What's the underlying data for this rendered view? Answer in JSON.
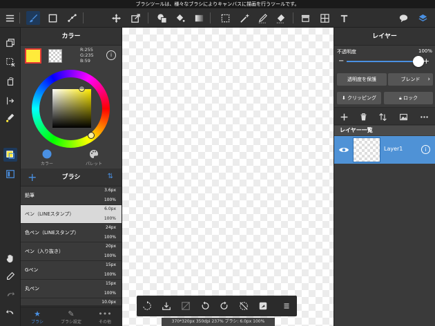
{
  "tooltip": "ブラシツールは、様々なブラシによりキャンバスに描画を行うツールです。",
  "colors": {
    "accent": "#4a90e2",
    "fg_color": "#ffeb3b",
    "selected_layer": "#4f92d6"
  },
  "toolbar": {
    "icons": [
      "menu-icon",
      "brush-icon",
      "shape-icon",
      "select-pen-icon",
      "move-icon",
      "transform-icon",
      "fill-shape-icon",
      "bucket-icon",
      "gradient-icon",
      "select-rect-icon",
      "magic-wand-icon",
      "select-pen-icon-2",
      "select-eraser-icon",
      "store-icon",
      "frame-icon",
      "text-icon",
      "speech-bubble-icon",
      "layers-icon"
    ]
  },
  "color_panel": {
    "title": "カラー",
    "rgb": {
      "r": "R:255",
      "g": "G:235",
      "b": "B:59"
    },
    "info": "i",
    "tabs": [
      "カラー",
      "パレット"
    ]
  },
  "brush_panel": {
    "title": "ブラシ",
    "add": "+",
    "sort": "⇅",
    "items": [
      {
        "name": "鉛筆",
        "size": "3.6px",
        "opacity": "100%"
      },
      {
        "name": "ペン（LINEスタンプ）",
        "size": "6.0px",
        "opacity": "100%",
        "selected": true
      },
      {
        "name": "色ペン（LINEスタンプ）",
        "size": "24px",
        "opacity": "100%"
      },
      {
        "name": "ペン（入り抜き）",
        "size": "20px",
        "opacity": "100%"
      },
      {
        "name": "Gペン",
        "size": "15px",
        "opacity": "100%"
      },
      {
        "name": "丸ペン",
        "size": "15px",
        "opacity": "100%"
      },
      {
        "name": "",
        "size": "10.0px",
        "opacity": ""
      }
    ],
    "tabs": [
      "ブラシ",
      "ブラシ設定",
      "その他"
    ]
  },
  "status": "370*320px 350dpi 237% ブラシ: 6.0px 100%",
  "layer_panel": {
    "title": "レイヤー",
    "opacity_label": "不透明度",
    "opacity_value": "100%",
    "opacity": 1.0,
    "minus": "−",
    "plus": "+",
    "protect_alpha": "透明度を保護",
    "blend": "ブレンド",
    "clipping": "クリッピング",
    "lock": "ロック",
    "list_title": "レイヤー一覧",
    "layers": [
      {
        "name": "Layer1",
        "visible": true
      }
    ],
    "info": "i"
  }
}
